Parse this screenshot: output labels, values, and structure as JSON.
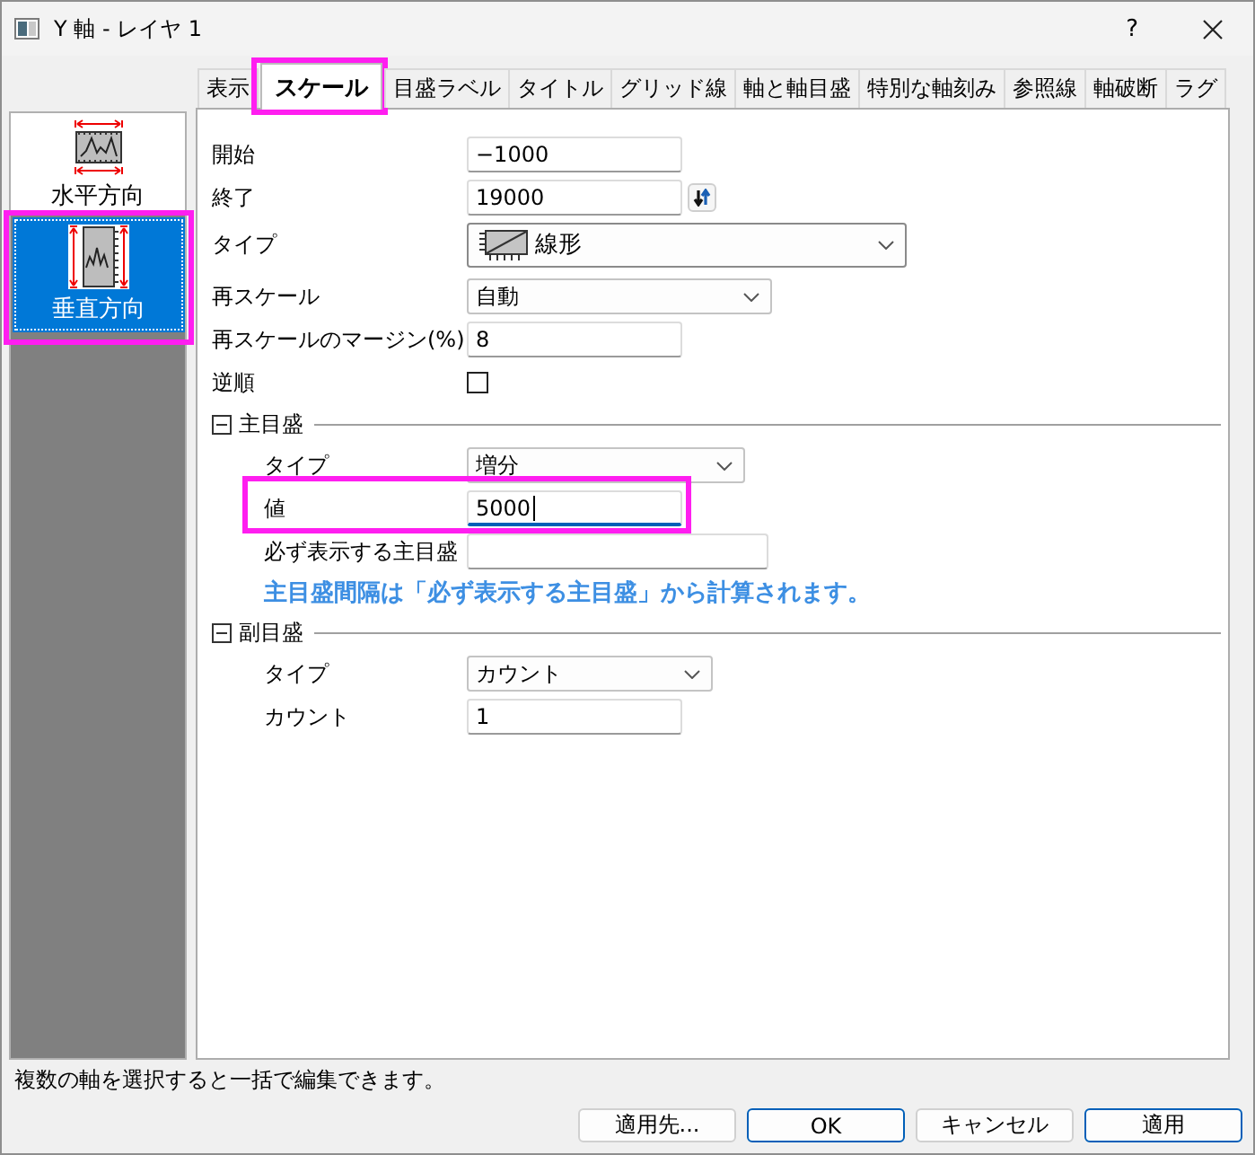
{
  "window": {
    "title": "Y 軸 - レイヤ 1",
    "help": "?"
  },
  "sidebar": {
    "items": [
      {
        "label": "水平方向",
        "kind": "horizontal",
        "selected": false,
        "highlighted": false
      },
      {
        "label": "垂直方向",
        "kind": "vertical",
        "selected": true,
        "highlighted": true
      }
    ]
  },
  "tabs": [
    {
      "label": "表示",
      "selected": false,
      "highlighted": false
    },
    {
      "label": "スケール",
      "selected": true,
      "highlighted": true
    },
    {
      "label": "目盛ラベル",
      "selected": false,
      "highlighted": false
    },
    {
      "label": "タイトル",
      "selected": false,
      "highlighted": false
    },
    {
      "label": "グリッド線",
      "selected": false,
      "highlighted": false
    },
    {
      "label": "軸と軸目盛",
      "selected": false,
      "highlighted": false
    },
    {
      "label": "特別な軸刻み",
      "selected": false,
      "highlighted": false
    },
    {
      "label": "参照線",
      "selected": false,
      "highlighted": false
    },
    {
      "label": "軸破断",
      "selected": false,
      "highlighted": false
    },
    {
      "label": "ラグ",
      "selected": false,
      "highlighted": false
    }
  ],
  "panel": {
    "rows": [
      {
        "kind": "text",
        "label": "開始",
        "value": "−1000",
        "focused": false
      },
      {
        "kind": "text",
        "label": "終了",
        "value": "19000",
        "focused": false,
        "swap": true
      },
      {
        "kind": "combo-icon",
        "label": "タイプ",
        "value": "線形"
      },
      {
        "kind": "combo",
        "label": "再スケール",
        "value": "自動"
      },
      {
        "kind": "text",
        "label": "再スケールのマージン(%)",
        "value": "8",
        "focused": false
      },
      {
        "kind": "checkbox",
        "label": "逆順",
        "checked": false
      },
      {
        "kind": "section",
        "label": "主目盛",
        "expanded": true,
        "children": [
          {
            "kind": "combo",
            "label": "タイプ",
            "value": "増分"
          },
          {
            "kind": "text",
            "label": "値",
            "value": "5000",
            "focused": true,
            "highlighted": true
          },
          {
            "kind": "text",
            "label": "必ず表示する主目盛",
            "focused": false
          },
          {
            "kind": "note",
            "text": "主目盛間隔は「必ず表示する主目盛」から計算されます。"
          }
        ]
      },
      {
        "kind": "section",
        "label": "副目盛",
        "expanded": true,
        "children": [
          {
            "kind": "combo",
            "label": "タイプ",
            "value": "カウント"
          },
          {
            "kind": "text",
            "label": "カウント",
            "value": "1",
            "focused": false
          }
        ]
      }
    ]
  },
  "status_bar": {
    "text": "複数の軸を選択すると一括で編集できます。"
  },
  "buttons": [
    {
      "label": "適用先...",
      "default": false
    },
    {
      "label": "OK",
      "default": true
    },
    {
      "label": "キャンセル",
      "default": false
    },
    {
      "label": "適用",
      "default": true
    }
  ]
}
